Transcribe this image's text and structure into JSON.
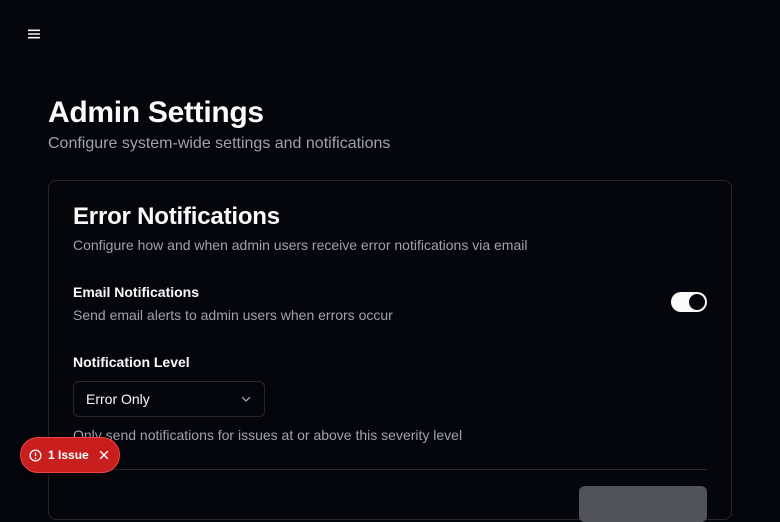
{
  "header": {
    "menu_icon": "hamburger-menu-icon"
  },
  "page": {
    "title": "Admin Settings",
    "subtitle": "Configure system-wide settings and notifications"
  },
  "card": {
    "title": "Error Notifications",
    "description": "Configure how and when admin users receive error notifications via email",
    "email_notifications": {
      "label": "Email Notifications",
      "description": "Send email alerts to admin users when errors occur",
      "enabled": true
    },
    "notification_level": {
      "label": "Notification Level",
      "selected": "Error Only",
      "help": "Only send notifications for issues at or above this severity level"
    }
  },
  "issue_badge": {
    "text": "1 Issue",
    "color": "#c81e1e"
  },
  "colors": {
    "background": "#05060c",
    "border": "#27272a",
    "muted_text": "#a1a1aa",
    "primary_text": "#fafafa"
  }
}
